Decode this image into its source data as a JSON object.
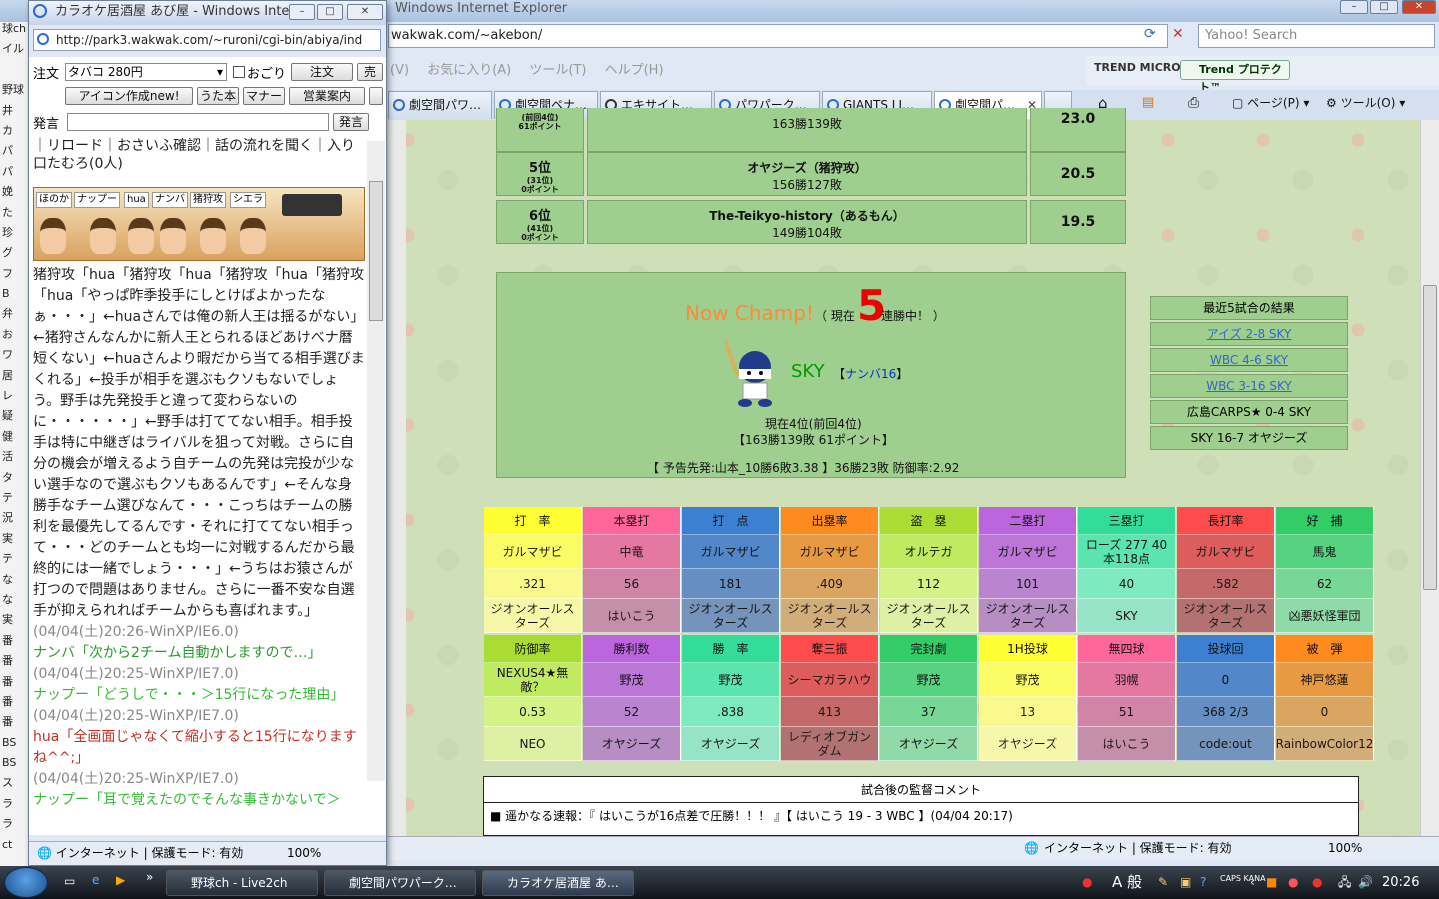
{
  "big_window": {
    "title": "Windows Internet Explorer",
    "address": "wakwak.com/~akebon/",
    "search_placeholder": "Yahoo! Search",
    "menu": [
      "(V)",
      "お気に入り(A)",
      "ツール(T)",
      "ヘルプ(H)"
    ],
    "trend": "TREND MICRO",
    "trend_protect": "Trend プロテクト™",
    "tabs": [
      "劇空間パワ…",
      "劇空間ペナ…",
      "エキサイト…",
      "パワパーク…",
      "GIANTS LI…",
      "劇空間パ…"
    ],
    "cmd": {
      "page": "ページ(P)",
      "tools": "ツール(O)"
    },
    "status": "インターネット | 保護モード: 有効",
    "zoom": "100%"
  },
  "ranking": [
    {
      "pos": "",
      "prev": "(前回4位)",
      "pts_small": "61ポイント",
      "team": "",
      "record": "163勝139敗",
      "points": "23.0"
    },
    {
      "pos": "5位",
      "prev": "(31位)",
      "pts_small": "0ポイント",
      "team": "オヤジーズ（猪狩攻）",
      "record": "156勝127敗",
      "points": "20.5"
    },
    {
      "pos": "6位",
      "prev": "(41位)",
      "pts_small": "0ポイント",
      "team": "The-Teikyo-history（あるもん）",
      "record": "149勝104敗",
      "points": "19.5"
    }
  ],
  "champ": {
    "now": "Now Champ!",
    "streak_pre": "（ 現在",
    "streak_num": "5",
    "streak_post": "連勝中！ ）",
    "team": "SKY",
    "owner_pre": "【",
    "owner": "ナンバ16",
    "owner_post": "】",
    "current_pos": "現在4位(前回4位)",
    "record": "【163勝139敗 61ポイント】",
    "forecast": "【 予告先発:山本_10勝6敗3.38 】36勝23敗  防御率:2.92"
  },
  "recent": {
    "header": "最近5試合の結果",
    "results": [
      "アイズ 2-8 SKY",
      "WBC 4-6 SKY",
      "WBC 3-16 SKY",
      "広島CARPS★ 0-4 SKY",
      "SKY 16-7 オヤジーズ"
    ]
  },
  "stats_top": [
    {
      "title": "打　率",
      "name": "ガルマザビ",
      "value": ".321",
      "team": "ジオンオールスターズ",
      "color": "#ffff33"
    },
    {
      "title": "本塁打",
      "name": "中竜",
      "value": "56",
      "team": "はいこう",
      "color": "#ff6699"
    },
    {
      "title": "打　点",
      "name": "ガルマザビ",
      "value": "181",
      "team": "ジオンオールスターズ",
      "color": "#3d7fd0"
    },
    {
      "title": "出塁率",
      "name": "ガルマザビ",
      "value": ".409",
      "team": "ジオンオールスターズ",
      "color": "#ff8a1f"
    },
    {
      "title": "盗　塁",
      "name": "オルテガ",
      "value": "112",
      "team": "ジオンオールスターズ",
      "color": "#aadd33"
    },
    {
      "title": "二塁打",
      "name": "ガルマザビ",
      "value": "101",
      "team": "ジオンオールスターズ",
      "color": "#bb66dd"
    },
    {
      "title": "三塁打",
      "name": "ローズ 277 40本118点",
      "value": "40",
      "team": "SKY",
      "color": "#33dd99"
    },
    {
      "title": "長打率",
      "name": "ガルマザビ",
      "value": ".582",
      "team": "ジオンオールスターズ",
      "color": "#ff4d4d"
    },
    {
      "title": "好　捕",
      "name": "馬鬼",
      "value": "62",
      "team": "凶悪妖怪軍団",
      "color": "#33cc66"
    }
  ],
  "stats_bottom": [
    {
      "title": "防御率",
      "name": "NEXUS4★無敵？",
      "value": "0.53",
      "team": "NEO",
      "color": "#aadd33"
    },
    {
      "title": "勝利数",
      "name": "野茂",
      "value": "52",
      "team": "オヤジーズ",
      "color": "#bb66dd"
    },
    {
      "title": "勝　率",
      "name": "野茂",
      "value": ".838",
      "team": "オヤジーズ",
      "color": "#33dd99"
    },
    {
      "title": "奪三振",
      "name": "シーマガラハウ",
      "value": "413",
      "team": "レディオブガンダム",
      "color": "#ff4d4d"
    },
    {
      "title": "完封劇",
      "name": "野茂",
      "value": "37",
      "team": "オヤジーズ",
      "color": "#33cc66"
    },
    {
      "title": "1H投球",
      "name": "野茂",
      "value": "13",
      "team": "オヤジーズ",
      "color": "#ffff33"
    },
    {
      "title": "無四球",
      "name": "羽幌",
      "value": "51",
      "team": "はいこう",
      "color": "#ff6699"
    },
    {
      "title": "投球回",
      "name": "0",
      "value": "368 2/3",
      "team": "code:out",
      "color": "#3d7fd0"
    },
    {
      "title": "被　弾",
      "name": "神戸悠蓮",
      "value": "0",
      "team": "RainbowColor12",
      "color": "#ff8a1f"
    }
  ],
  "comment": {
    "header": "試合後の監督コメント",
    "text": "■ 遥かなる速報：『 はいこうが16点差で圧勝！！！ 』【 はいこう 19 - 3 WBC 】(04/04 20:17)"
  },
  "small_window": {
    "title": "カラオケ居酒屋 あび屋 - Windows Inte...",
    "address": "http://park3.wakwak.com/~ruroni/cgi-bin/abiya/ind",
    "order_label": "注文",
    "order_value": "タバコ 280円",
    "ogori": "おごり",
    "order_btn": "注文",
    "order_btn2": "売",
    "buttons": [
      "アイコン作成new!",
      "うた本",
      "マナー",
      "営業案内"
    ],
    "say_label": "発言",
    "say_btn": "発言",
    "links": "｜リロード｜おさいふ確認｜話の流れを聞く｜入り口たむろ(0人)",
    "banner_tags": [
      "ほのか",
      "ナップー",
      "hua",
      "ナンバ",
      "猪狩攻",
      "シエラ"
    ],
    "status": "インターネット | 保護モード: 有効",
    "zoom": "100%"
  },
  "chat": [
    {
      "text": "猪狩攻「hua「猪狩攻「hua「猪狩攻「hua「猪狩攻「hua「やっぱ昨季投手にしとけばよかったなぁ・・・」←huaさんでは俺の新人王は揺るがない」←猪狩さんなんかに新人王とられるほどあけべナ暦短くない」←huaさんより暇だから当てる相手選びまくれる」←投手が相手を選ぶもクソもないでしょう。野手は先発投手と違って変わらないのに・・・・・・」←野手は打ててない相手。相手投手は特に中継ぎはライバルを狙って対戦。さらに自分の機会が増えるよう自チームの先発は完投が少ない選手なので選ぶもクソもあるんです」←そんな身勝手なチーム選びなんて・・・こっちはチームの勝利を最優先してるんです・それに打ててない相手って・・・どのチームとも均一に対戦するんだから最終的には一緒でしょう・・・」←うちはお猿さんが打つので問題はありません。さらに一番不安な自選手が抑えられればチームからも喜ばれます。」",
      "color": "#222"
    },
    {
      "text": "(04/04(土)20:26-WinXP/IE6.0)",
      "color": "#888"
    },
    {
      "text": "ナンバ「次から2チーム自動かしますので…」",
      "color": "#2a9a2a"
    },
    {
      "text": "(04/04(土)20:25-WinXP/IE7.0)",
      "color": "#888"
    },
    {
      "text": "ナップー「どうしで・・・＞15行になった理由」",
      "color": "#33bb33"
    },
    {
      "text": "(04/04(土)20:25-WinXP/IE7.0)",
      "color": "#888"
    },
    {
      "text": "hua「全画面じゃなくて縮小すると15行になりますね^^;」",
      "color": "#c03020"
    },
    {
      "text": "(04/04(土)20:25-WinXP/IE7.0)",
      "color": "#888"
    },
    {
      "text": "ナップー「耳で覚えたのでそんな事きかないで＞",
      "color": "#33bb33"
    }
  ],
  "far_left": [
    "球ch",
    "イル",
    "",
    "野球",
    "井",
    "カ",
    "パ",
    "パ",
    "娩",
    "た",
    "珍",
    "グ",
    "フ",
    "B",
    "弁",
    "お",
    "ワ",
    "居",
    "レ",
    "疑",
    "健",
    "活",
    "タ",
    "テ",
    "況",
    "実",
    "テ",
    "な",
    "な",
    "実",
    "番",
    "番",
    "番",
    "番",
    "番",
    "BS",
    "BS",
    "ス",
    "ラ",
    "ラ",
    "ct"
  ],
  "taskbar": {
    "tasks": [
      "野球ch - Live2ch",
      "劇空間パワパーク…",
      "カラオケ居酒屋 あ…"
    ],
    "time": "20:26",
    "ime": "A 般",
    "caps": "CAPS KANA"
  }
}
